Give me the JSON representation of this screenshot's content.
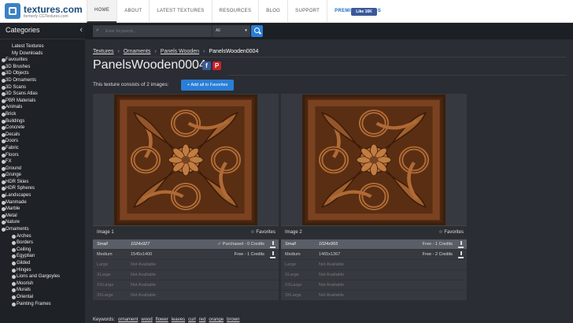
{
  "brand": {
    "name": "textures.com",
    "tagline": "formerly CGTextures.com"
  },
  "nav": [
    "HOME",
    "ABOUT",
    "LATEST TEXTURES",
    "RESOURCES",
    "BLOG",
    "SUPPORT",
    "PREMIUM ACCESS"
  ],
  "facebook_like": "Like 16K",
  "sidebar": {
    "title": "Categories",
    "links": [
      "Latest Textures",
      "My Downloads"
    ],
    "categories": [
      "Favourites",
      "3D Brushes",
      "3D Objects",
      "3D Ornaments",
      "3D Scans",
      "3D Scans Atlas",
      "PBR Materials",
      "Animals",
      "Brick",
      "Buildings",
      "Concrete",
      "Decals",
      "Doors",
      "Fabric",
      "Floors",
      "FX",
      "Ground",
      "Grunge",
      "HDR Skies",
      "HDR Spheres",
      "Landscapes",
      "Manmade",
      "Marble",
      "Metal",
      "Nature",
      "Ornaments"
    ],
    "subcategories": [
      "Arches",
      "Borders",
      "Ceiling",
      "Egyptian",
      "Gilded",
      "Hinges",
      "Lions and Gargoyles",
      "Moorish",
      "Murals",
      "Oriental",
      "Painting Frames"
    ]
  },
  "search": {
    "placeholder": "Enter Keywords...",
    "filter": "All"
  },
  "breadcrumb": {
    "root": "Textures",
    "cat": "Ornaments",
    "sub": "Panels Wooden",
    "current": "PanelsWooden0004"
  },
  "title": "PanelsWooden0004",
  "share": {
    "fb": "f",
    "pin": "P"
  },
  "consists_text": "This texture consists of 2 images:",
  "add_all_label": "Add all to Favorites",
  "images": [
    {
      "label": "Image 1",
      "favorites": "Favorites",
      "rows": [
        {
          "name": "Small",
          "dims": "1024x927",
          "price": "✓ Purchased - 0 Credits"
        },
        {
          "name": "Medium",
          "dims": "1545x1400",
          "price": "Free - 1 Credits"
        },
        {
          "name": "Large",
          "dims": "Not Available",
          "price": ""
        },
        {
          "name": "XLarge",
          "dims": "Not Available",
          "price": ""
        },
        {
          "name": "XXLarge",
          "dims": "Not Available",
          "price": ""
        },
        {
          "name": "3XLarge",
          "dims": "Not Available",
          "price": ""
        }
      ]
    },
    {
      "label": "Image 2",
      "favorites": "Favorites",
      "rows": [
        {
          "name": "Small",
          "dims": "1024x955",
          "price": "Free - 1 Credits"
        },
        {
          "name": "Medium",
          "dims": "1465x1367",
          "price": "Free - 2 Credits"
        },
        {
          "name": "Large",
          "dims": "Not Available",
          "price": ""
        },
        {
          "name": "XLarge",
          "dims": "Not Available",
          "price": ""
        },
        {
          "name": "XXLarge",
          "dims": "Not Available",
          "price": ""
        },
        {
          "name": "3XLarge",
          "dims": "Not Available",
          "price": ""
        }
      ]
    }
  ],
  "keywords_label": "Keywords:",
  "keywords": [
    "ornament",
    "wood",
    "flower",
    "leaves",
    "curl",
    "red",
    "orange",
    "brown"
  ],
  "colors": {
    "accent": "#2a7ed6",
    "bg": "#2a2d33",
    "sidebar": "#1e2126",
    "wood": "#8a4a22"
  }
}
